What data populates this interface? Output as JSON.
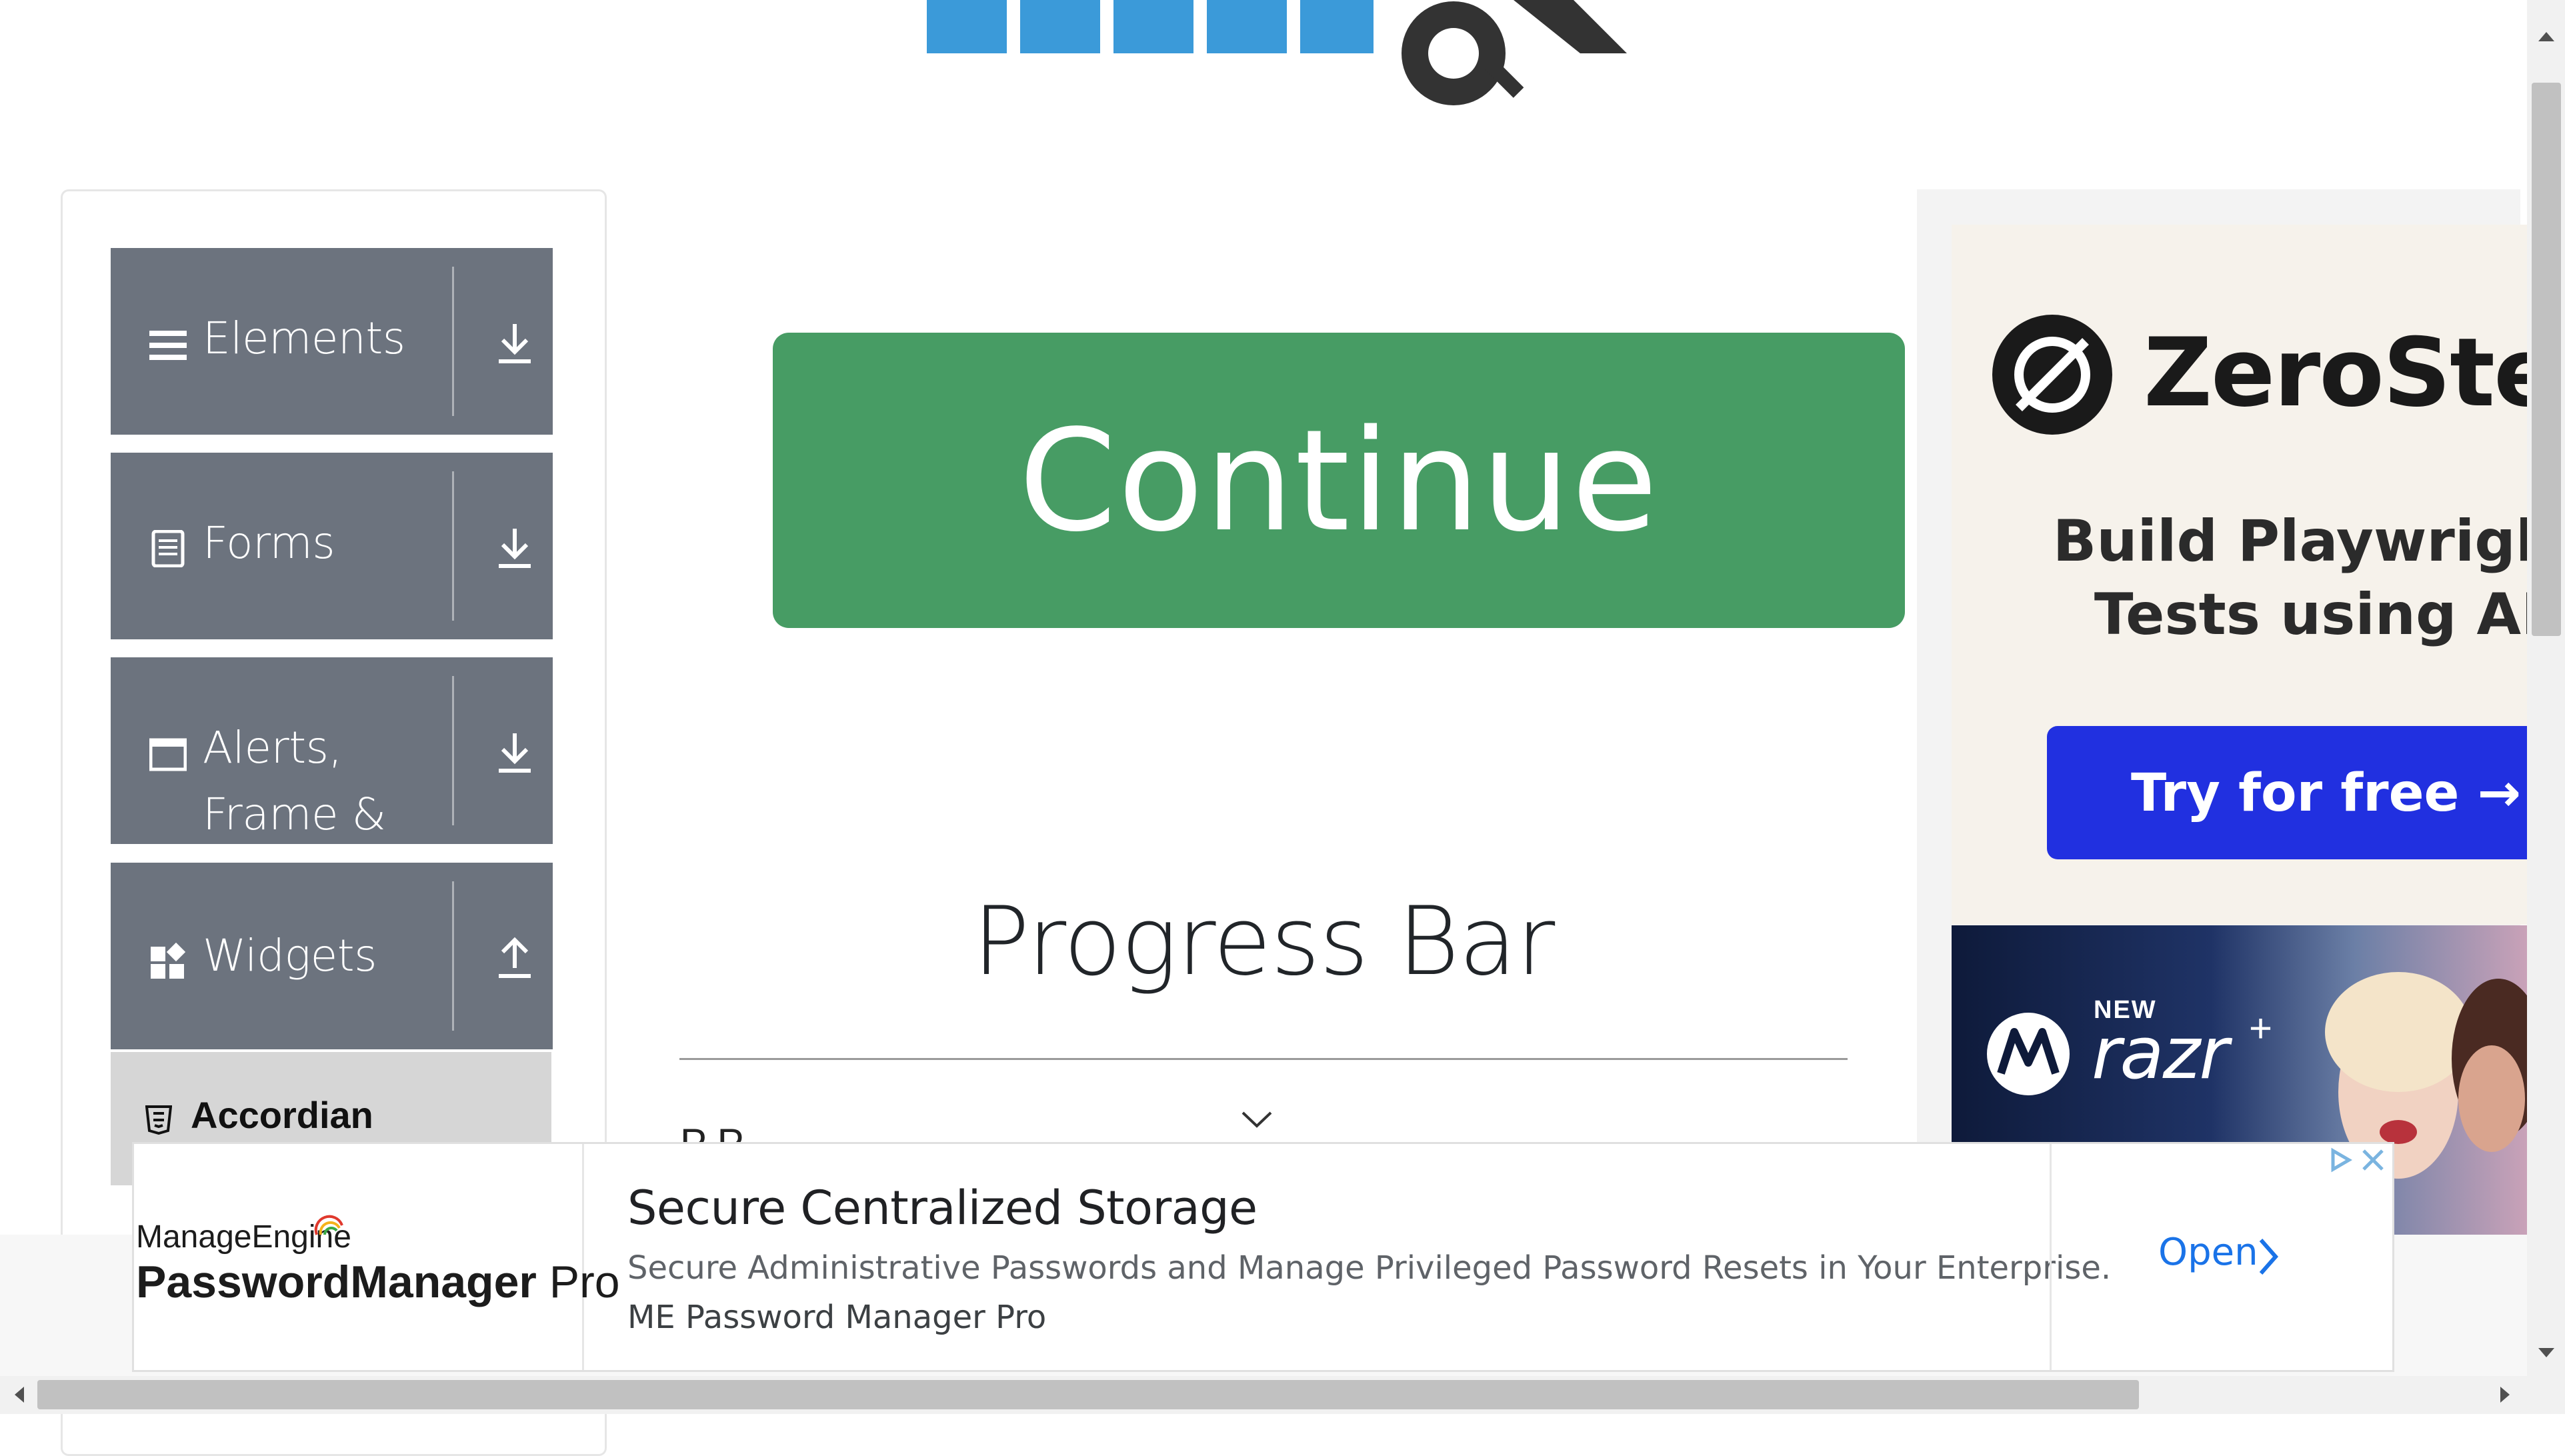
{
  "logo": {
    "text": "TOOLSQA"
  },
  "sidebar": {
    "groups": [
      {
        "label": "Elements",
        "icon": "hamburger-icon",
        "toggle": "expand-arrow-down"
      },
      {
        "label": "Forms",
        "icon": "document-icon",
        "toggle": "expand-arrow-down"
      },
      {
        "label": "Alerts, Frame & Windows",
        "icon": "window-icon",
        "toggle": "expand-arrow-down"
      },
      {
        "label": "Widgets",
        "icon": "widgets-icon",
        "toggle": "collapse-arrow-up"
      }
    ],
    "active_item": {
      "label": "Accordian",
      "icon": "html5-icon"
    }
  },
  "main": {
    "continue_button": "Continue",
    "page_title": "Progress Bar",
    "partial_text": "P                 P"
  },
  "ad_right": {
    "zerostep": {
      "brand": "ZeroStep",
      "headline_line1": "Build Playwright",
      "headline_line2": "Tests using AI",
      "cta": "Try for free →"
    },
    "razr": {
      "new": "NEW",
      "brand": "razr",
      "plus": "+"
    }
  },
  "bottom_ad": {
    "logo_small": "ManageEngine",
    "logo_big": "PasswordManager",
    "logo_big_suffix": " Pro",
    "headline": "Secure Centralized Storage",
    "description": "Secure Administrative Passwords and Manage Privileged Password Resets in Your Enterprise.",
    "advertiser": "ME Password Manager Pro",
    "cta": "Open"
  },
  "colors": {
    "sidebar_group": "#6c737e",
    "continue_green": "#479c64",
    "cta_blue": "#2130e0",
    "link_blue": "#1a73e8"
  }
}
